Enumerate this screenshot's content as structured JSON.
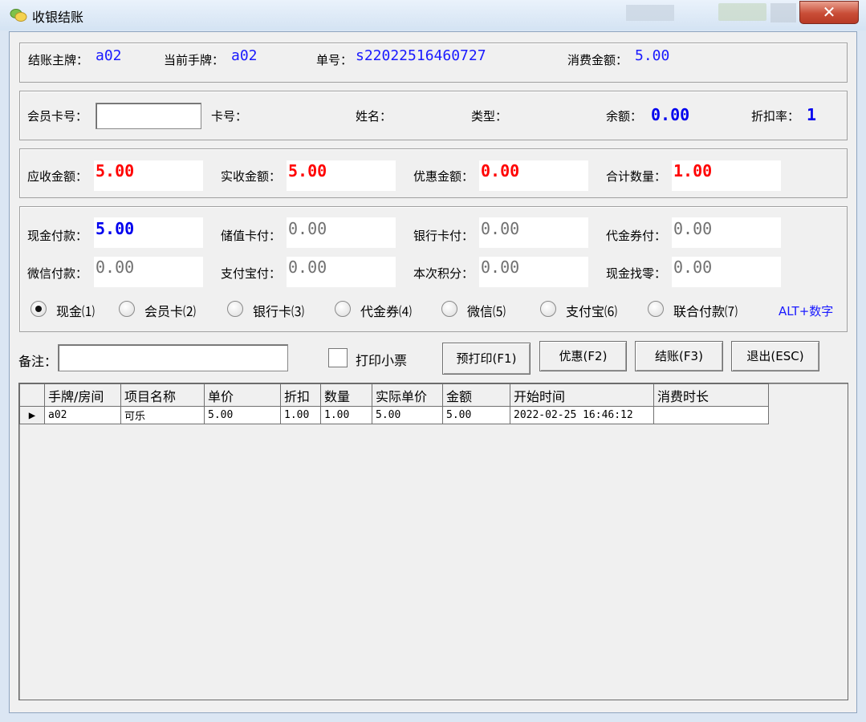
{
  "window": {
    "title": "收银结账",
    "close_glyph": "✕"
  },
  "header": {
    "main_tag_label": "结账主牌：",
    "main_tag_value": "a02",
    "current_tag_label": "当前手牌：",
    "current_tag_value": "a02",
    "order_no_label": "单号：",
    "order_no_value": "s22022516460727",
    "consume_amount_label": "消费金额：",
    "consume_amount_value": "5.00"
  },
  "member": {
    "card_no_input_label": "会员卡号：",
    "card_no_input_value": "",
    "card_no_label": "卡号：",
    "name_label": "姓名：",
    "type_label": "类型：",
    "balance_label": "余额：",
    "balance_value": "0.00",
    "discount_rate_label": "折扣率：",
    "discount_rate_value": "1"
  },
  "amounts": {
    "receivable_label": "应收金额：",
    "receivable_value": "5.00",
    "received_label": "实收金额：",
    "received_value": "5.00",
    "discount_amount_label": "优惠金额：",
    "discount_amount_value": "0.00",
    "total_qty_label": "合计数量：",
    "total_qty_value": "1.00"
  },
  "payments": {
    "cash_label": "现金付款：",
    "cash_value": "5.00",
    "stored_card_label": "储值卡付：",
    "stored_card_value": "0.00",
    "bank_card_label": "银行卡付：",
    "bank_card_value": "0.00",
    "voucher_label": "代金券付：",
    "voucher_value": "0.00",
    "wechat_label": "微信付款：",
    "wechat_value": "0.00",
    "alipay_label": "支付宝付：",
    "alipay_value": "0.00",
    "points_label": "本次积分：",
    "points_value": "0.00",
    "change_label": "现金找零：",
    "change_value": "0.00",
    "methods": [
      "现金⑴",
      "会员卡⑵",
      "银行卡⑶",
      "代金券⑷",
      "微信⑸",
      "支付宝⑹",
      "联合付款⑺"
    ],
    "selected_method": "现金⑴",
    "hotkey_hint": "ALT+数字"
  },
  "actions": {
    "remark_label": "备注：",
    "remark_value": "",
    "print_receipt_label": "打印小票",
    "preprint_button": "预打印(F1)",
    "discount_button": "优惠(F2)",
    "checkout_button": "结账(F3)",
    "exit_button": "退出(ESC)"
  },
  "grid": {
    "columns": [
      "手牌/房间",
      "项目名称",
      "单价",
      "折扣",
      "数量",
      "实际单价",
      "金额",
      "开始时间",
      "消费时长"
    ],
    "current_row_marker": "▶",
    "rows": [
      [
        "a02",
        "可乐",
        "5.00",
        "1.00",
        "1.00",
        "5.00",
        "5.00",
        "2022-02-25 16:46:12",
        ""
      ]
    ]
  },
  "colors": {
    "accent_blue": "#1a1aff",
    "value_red": "#ff0000",
    "close_red": "#c94d37"
  }
}
